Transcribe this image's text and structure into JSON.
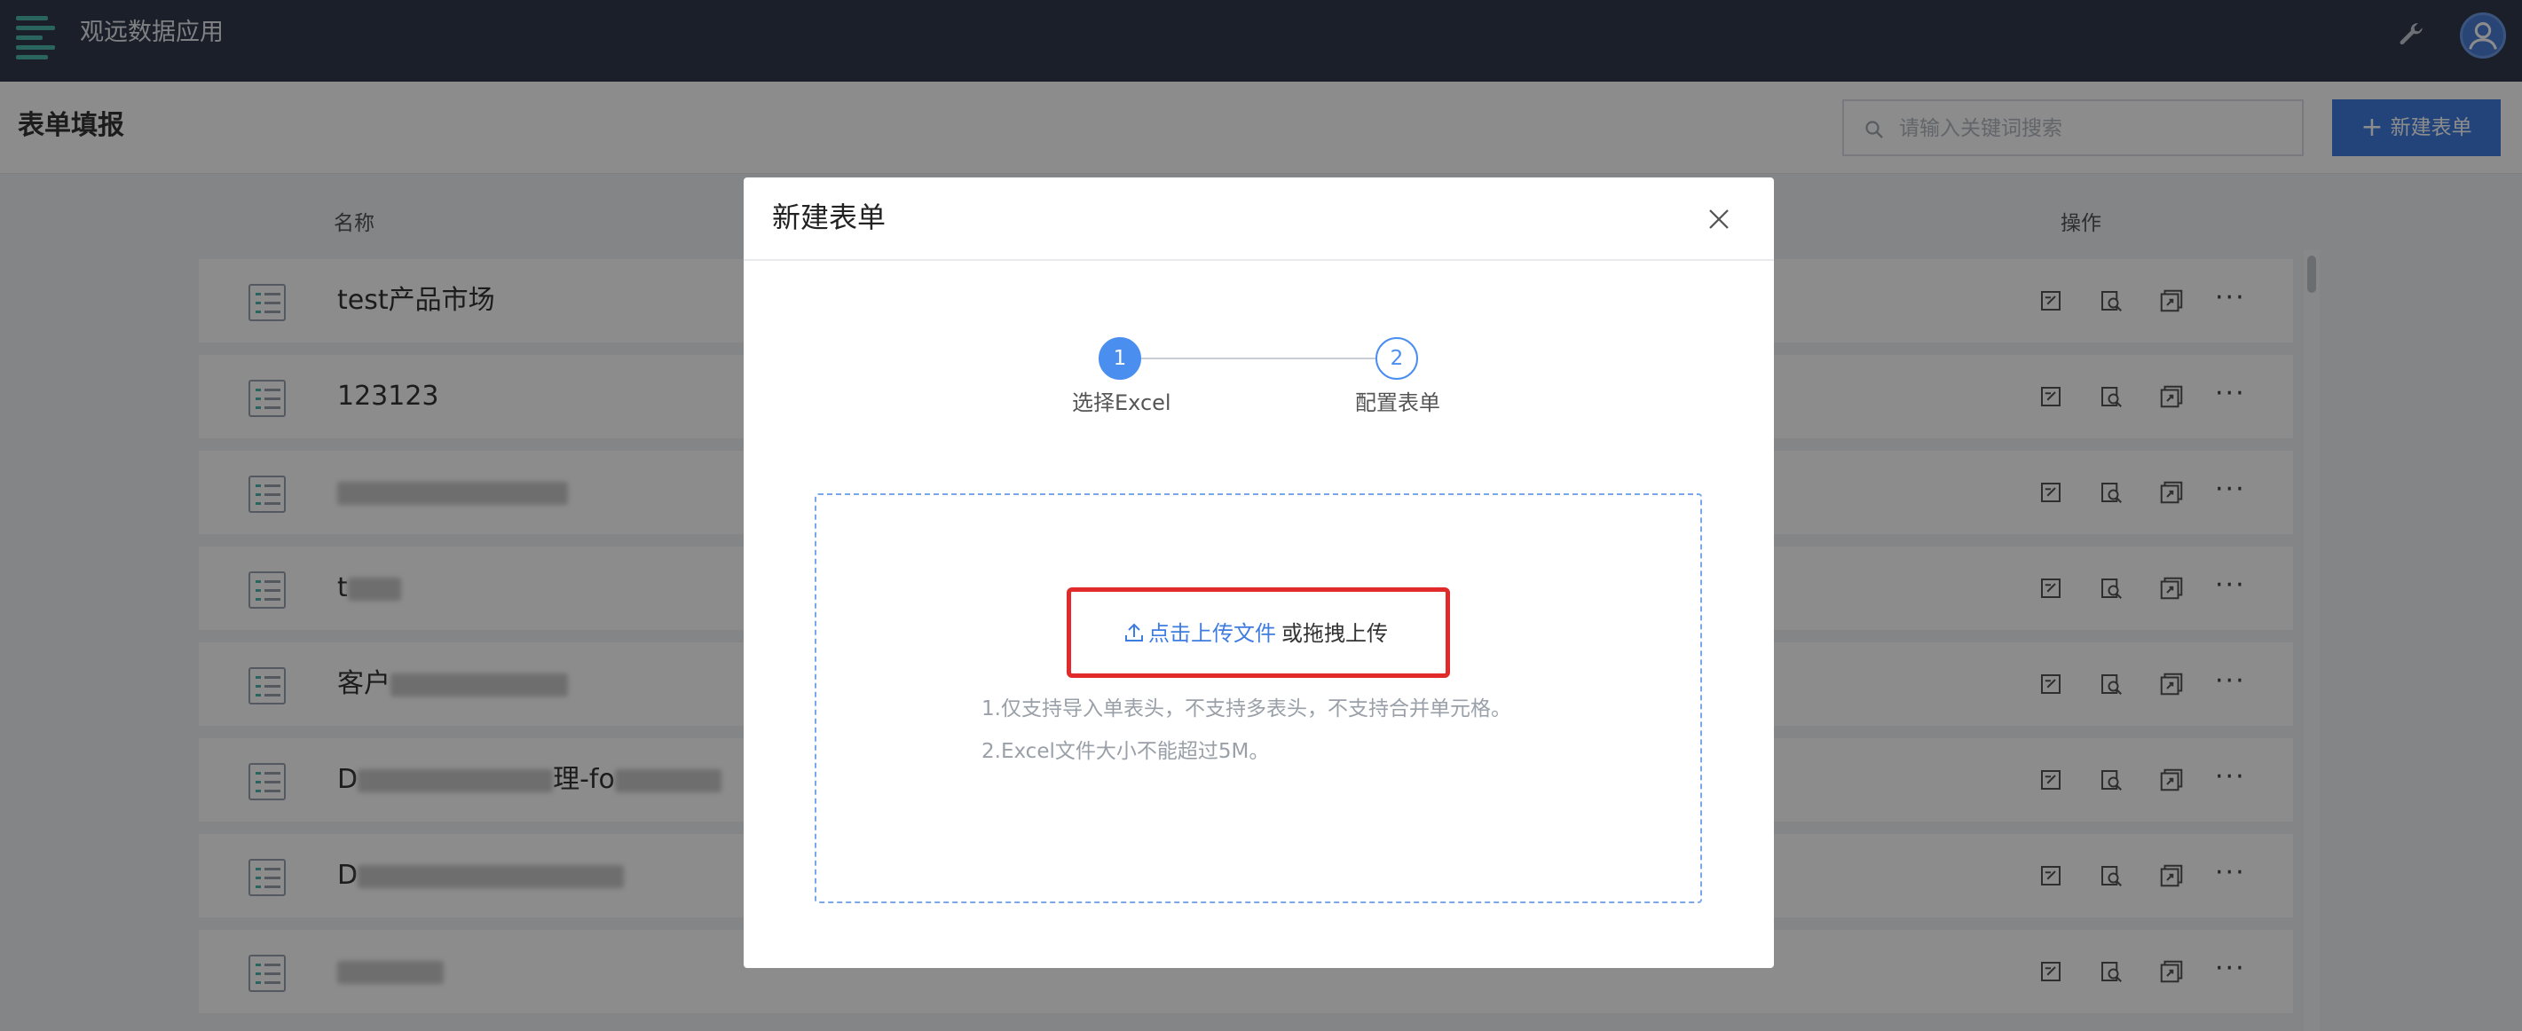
{
  "app": {
    "title": "观远数据应用"
  },
  "header": {
    "title": "表单填报",
    "search_placeholder": "请输入关键词搜索",
    "new_button": "新建表单"
  },
  "table": {
    "columns": {
      "name": "名称",
      "ops": "操作"
    },
    "rows": [
      {
        "name": "test产品市场"
      },
      {
        "name": "123123"
      },
      {
        "name": "",
        "prefix": ""
      },
      {
        "name": "t"
      },
      {
        "name": "客户"
      },
      {
        "name": "D",
        "suffix": "理-fo"
      },
      {
        "name": "D"
      },
      {
        "name": ""
      }
    ]
  },
  "modal": {
    "title": "新建表单",
    "steps": [
      {
        "number": "1",
        "label": "选择Excel"
      },
      {
        "number": "2",
        "label": "配置表单"
      }
    ],
    "upload_link": "点击上传文件",
    "upload_or": "或拖拽上传",
    "hints": [
      "1.仅支持导入单表头，不支持多表头，不支持合并单元格。",
      "2.Excel文件大小不能超过5M。"
    ]
  },
  "colors": {
    "topbar": "#323a4b",
    "accent": "#3f7ce0",
    "highlight": "#e12b2b"
  }
}
